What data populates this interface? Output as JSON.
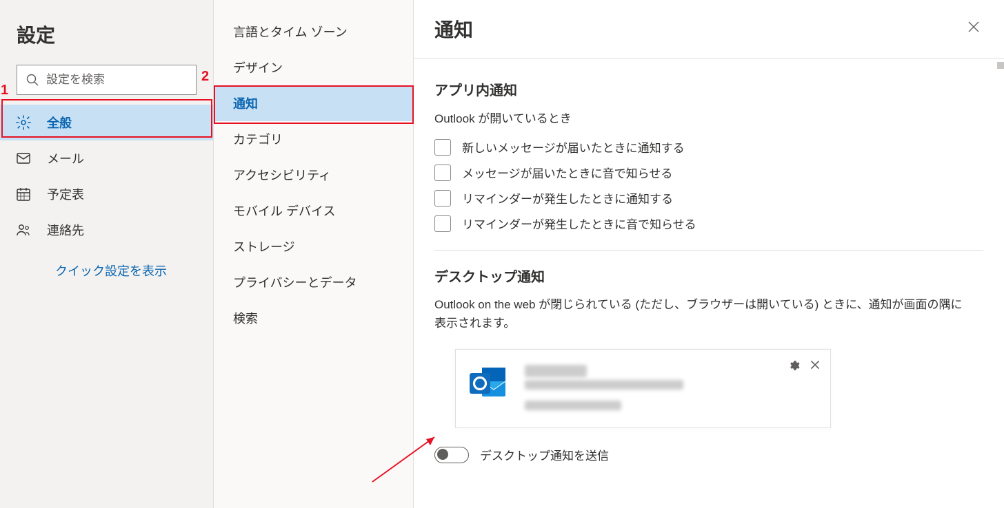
{
  "annotations": {
    "num1": "1",
    "num2": "2"
  },
  "leftPanel": {
    "title": "設定",
    "searchPlaceholder": "設定を検索",
    "categories": [
      {
        "id": "general",
        "label": "全般",
        "selected": true
      },
      {
        "id": "mail",
        "label": "メール"
      },
      {
        "id": "calendar",
        "label": "予定表"
      },
      {
        "id": "people",
        "label": "連絡先"
      }
    ],
    "quickLink": "クイック設定を表示"
  },
  "midPanel": {
    "items": [
      {
        "id": "language",
        "label": "言語とタイム ゾーン"
      },
      {
        "id": "design",
        "label": "デザイン"
      },
      {
        "id": "notif",
        "label": "通知",
        "selected": true
      },
      {
        "id": "category",
        "label": "カテゴリ"
      },
      {
        "id": "access",
        "label": "アクセシビリティ"
      },
      {
        "id": "mobile",
        "label": "モバイル デバイス"
      },
      {
        "id": "storage",
        "label": "ストレージ"
      },
      {
        "id": "privacy",
        "label": "プライバシーとデータ"
      },
      {
        "id": "search",
        "label": "検索"
      }
    ]
  },
  "rightPanel": {
    "title": "通知",
    "sectionInApp": {
      "heading": "アプリ内通知",
      "sub": "Outlook が開いているとき",
      "checks": [
        "新しいメッセージが届いたときに通知する",
        "メッセージが届いたときに音で知らせる",
        "リマインダーが発生したときに通知する",
        "リマインダーが発生したときに音で知らせる"
      ]
    },
    "sectionDesktop": {
      "heading": "デスクトップ通知",
      "desc": "Outlook on the web が閉じられている (ただし、ブラウザーは開いている) ときに、通知が画面の隅に表示されます。",
      "toggleLabel": "デスクトップ通知を送信"
    }
  }
}
